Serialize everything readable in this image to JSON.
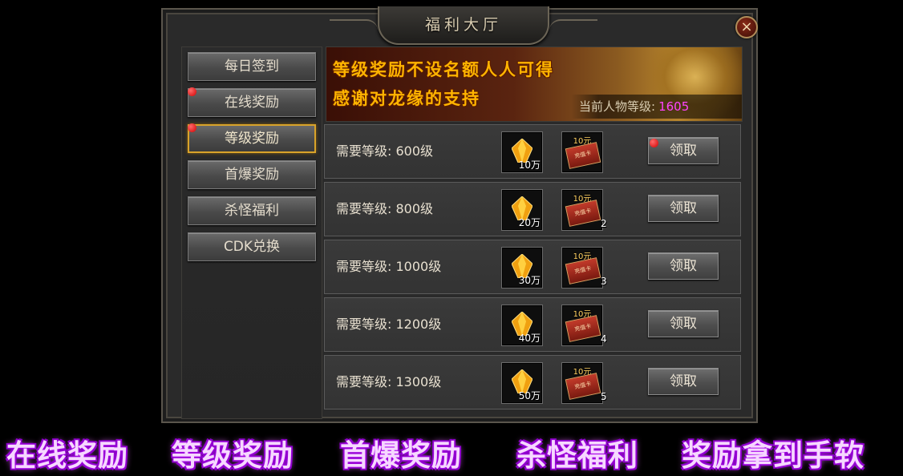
{
  "window": {
    "title": "福利大厅",
    "close_label": "×"
  },
  "tabs": [
    {
      "label": "每日签到",
      "active": false,
      "dot": false
    },
    {
      "label": "在线奖励",
      "active": false,
      "dot": true
    },
    {
      "label": "等级奖励",
      "active": true,
      "dot": true
    },
    {
      "label": "首爆奖励",
      "active": false,
      "dot": false
    },
    {
      "label": "杀怪福利",
      "active": false,
      "dot": false
    },
    {
      "label": "CDK兑换",
      "active": false,
      "dot": false
    }
  ],
  "banner": {
    "line1": "等级奖励不设名额人人可得",
    "line2": "感谢对龙缘的支持",
    "level_label": "当前人物等级:",
    "level_value": "1605"
  },
  "rewards": [
    {
      "label": "需要等级: 600级",
      "gold_qty": "10万",
      "card_top": "10元",
      "card_qty": "",
      "claim": "领取",
      "dot": true
    },
    {
      "label": "需要等级: 800级",
      "gold_qty": "20万",
      "card_top": "10元",
      "card_qty": "2",
      "claim": "领取",
      "dot": false
    },
    {
      "label": "需要等级: 1000级",
      "gold_qty": "30万",
      "card_top": "10元",
      "card_qty": "3",
      "claim": "领取",
      "dot": false
    },
    {
      "label": "需要等级: 1200级",
      "gold_qty": "40万",
      "card_top": "10元",
      "card_qty": "4",
      "claim": "领取",
      "dot": false
    },
    {
      "label": "需要等级: 1300级",
      "gold_qty": "50万",
      "card_top": "10元",
      "card_qty": "5",
      "claim": "领取",
      "dot": false
    }
  ],
  "card_art_text": "充值卡",
  "slogan": [
    "在线奖励",
    "等级奖励",
    "首爆奖励",
    "杀怪福利",
    "奖励拿到手软"
  ],
  "colors": {
    "accent_gold": "#d9a32a",
    "level_value": "#ff44ff",
    "banner_text": "#ffb400",
    "slogan_glow": "#c010ff"
  }
}
